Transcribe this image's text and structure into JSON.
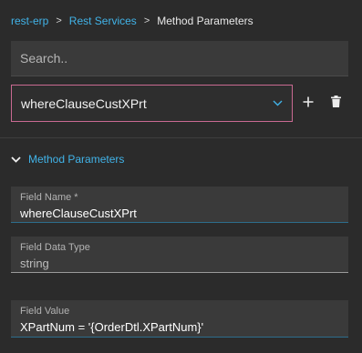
{
  "breadcrumb": {
    "items": [
      "rest-erp",
      "Rest Services"
    ],
    "separator": ">",
    "current": "Method Parameters"
  },
  "search": {
    "placeholder": "Search.."
  },
  "selector": {
    "value": "whereClauseCustXPrt"
  },
  "section": {
    "title": "Method Parameters",
    "expanded": true
  },
  "fields": {
    "field_name": {
      "label": "Field Name *",
      "value": "whereClauseCustXPrt"
    },
    "field_data_type": {
      "label": "Field Data Type",
      "value": "string"
    },
    "field_value": {
      "label": "Field Value",
      "value": "XPartNum = '{OrderDtl.XPartNum}'"
    }
  },
  "icons": {
    "add": "plus-icon",
    "delete": "trash-icon",
    "dropdown": "chevron-down-icon",
    "section_toggle": "chevron-down-icon"
  },
  "colors": {
    "background": "#2b2b2b",
    "link": "#41b3e8",
    "select_border": "#c96a92",
    "field_bg": "#3a3a3a"
  }
}
